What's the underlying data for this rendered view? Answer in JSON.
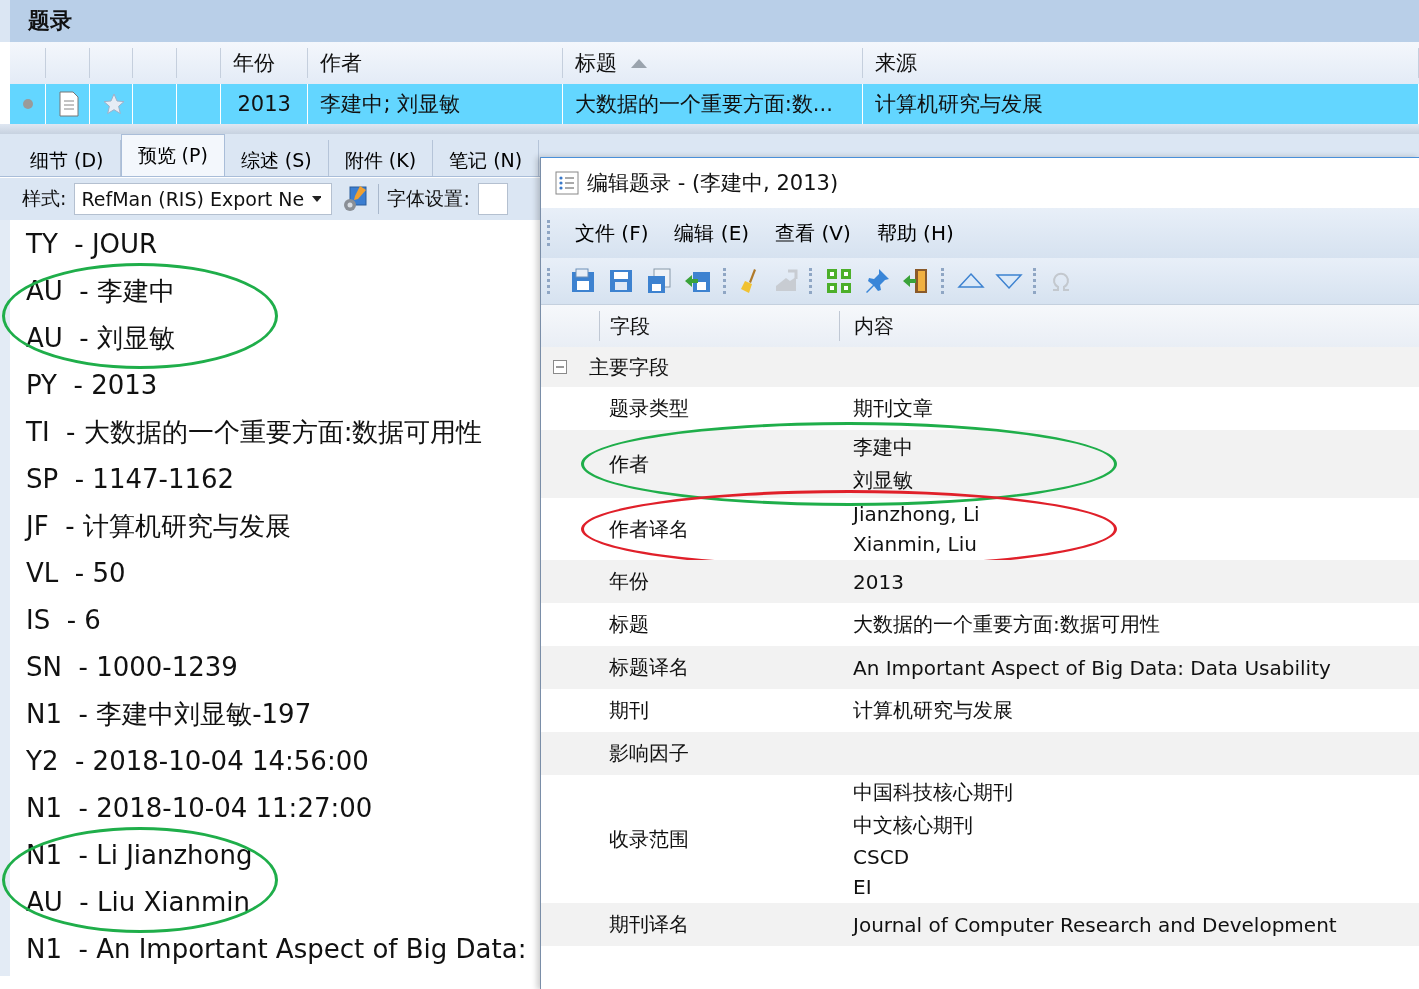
{
  "panel": {
    "title": "题录"
  },
  "table": {
    "columns": [
      {
        "label": "年份"
      },
      {
        "label": "作者"
      },
      {
        "label": "标题",
        "sorted": true
      },
      {
        "label": "来源"
      }
    ],
    "rows": [
      {
        "selected": true,
        "year": "2013",
        "author": "李建中; 刘显敏",
        "title": "大数据的一个重要方面:数...",
        "source": "计算机研究与发展"
      }
    ]
  },
  "tabs": [
    {
      "label": "细节 (D)",
      "selected": false
    },
    {
      "label": "预览 (P)",
      "selected": true
    },
    {
      "label": "综述 (S)",
      "selected": false
    },
    {
      "label": "附件 (K)",
      "selected": false
    },
    {
      "label": "笔记 (N)",
      "selected": false
    }
  ],
  "style_bar": {
    "style_label": "样式:",
    "style_value": "RefMan (RIS) Export Ne",
    "font_label": "字体设置:"
  },
  "preview_lines": [
    {
      "text": "TY  - JOUR"
    },
    {
      "text": "AU  - 李建中",
      "color": "#1fae4a"
    },
    {
      "text": "AU  - 刘显敏",
      "color": "#1fae4a"
    },
    {
      "text": "PY  - 2013"
    },
    {
      "text": "TI  - 大数据的一个重要方面:数据可用性"
    },
    {
      "text": "SP  - 1147-1162"
    },
    {
      "text": "JF  - 计算机研究与发展"
    },
    {
      "text": "VL  - 50"
    },
    {
      "text": "IS  - 6"
    },
    {
      "text": "SN  - 1000-1239"
    },
    {
      "text": "N1  - 李建中刘显敏-197"
    },
    {
      "text": "Y2  - 2018-10-04 14:56:00"
    },
    {
      "text": "N1  - 2018-10-04 11:27:00"
    },
    {
      "text": "N1  - Li Jianzhong",
      "color": "#1fae4a"
    },
    {
      "text": "AU  - Liu Xianmin",
      "color": "#1fae4a"
    },
    {
      "text": "N1  - An Important Aspect of Big Data:"
    }
  ],
  "dialog": {
    "title": "编辑题录 - (李建中, 2013)",
    "menu": [
      "文件 (F)",
      "编辑 (E)",
      "查看 (V)",
      "帮助 (H)"
    ],
    "columns": [
      "字段",
      "内容"
    ],
    "group": {
      "label": "主要字段",
      "expanded": true
    },
    "fields": [
      {
        "name": "题录类型",
        "values": [
          "期刊文章"
        ]
      },
      {
        "name": "作者",
        "values": [
          "李建中",
          "刘显敏"
        ],
        "color": "#1fae4a"
      },
      {
        "name": "作者译名",
        "values": [
          "Jianzhong, Li",
          "Xianmin, Liu"
        ],
        "color": "#e0202a"
      },
      {
        "name": "年份",
        "values": [
          "2013"
        ]
      },
      {
        "name": "标题",
        "values": [
          "大数据的一个重要方面:数据可用性"
        ]
      },
      {
        "name": "标题译名",
        "values": [
          "An Important Aspect of Big Data: Data Usability"
        ]
      },
      {
        "name": "期刊",
        "values": [
          "计算机研究与发展"
        ]
      },
      {
        "name": "影响因子"
      },
      {
        "name": "收录范围",
        "values": [
          "中国科技核心期刊",
          "中文核心期刊",
          "CSCD",
          "EI"
        ]
      },
      {
        "name": "期刊译名",
        "values": [
          "Journal of Computer Research and Development"
        ]
      }
    ]
  }
}
